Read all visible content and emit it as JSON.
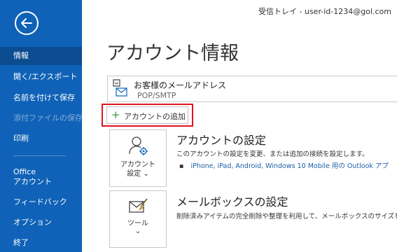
{
  "header": {
    "title": "受信トレイ - user-id-1234@gol.com"
  },
  "sidebar": {
    "items": [
      {
        "label": "情報"
      },
      {
        "label": "開く/エクスポート"
      },
      {
        "label": "名前を付けて保存"
      },
      {
        "label": "添付ファイルの保存"
      },
      {
        "label": "印刷"
      },
      {
        "label_line1": "Office",
        "label_line2": "アカウント"
      },
      {
        "label": "フィードバック"
      },
      {
        "label": "オプション"
      },
      {
        "label": "終了"
      }
    ]
  },
  "main": {
    "title": "アカウント情報",
    "account": {
      "name": "お客様のメールアドレス",
      "type": "POP/SMTP"
    },
    "add_account_label": "アカウントの追加",
    "account_settings": {
      "tile_line1": "アカウント",
      "tile_line2": "設定",
      "tile_chevron": "⌄",
      "title": "アカウントの設定",
      "description": "このアカウントの設定を変更、または追加の接続を設定します。",
      "bullet": "▪",
      "link": "iPhone, iPad, Android, Windows 10 Mobile 用の Outlook アプ"
    },
    "mailbox_settings": {
      "tile_line1": "ツール",
      "tile_chevron": "⌄",
      "title": "メールボックスの設定",
      "description": "削除済みアイテムの完全削除や整理を利用して、メールボックスのサイズを管理"
    }
  },
  "colors": {
    "sidebar": "#0f62b7",
    "sidebar_active": "#0c4c91",
    "highlight": "#e0131d",
    "link": "#1c5fa8"
  }
}
